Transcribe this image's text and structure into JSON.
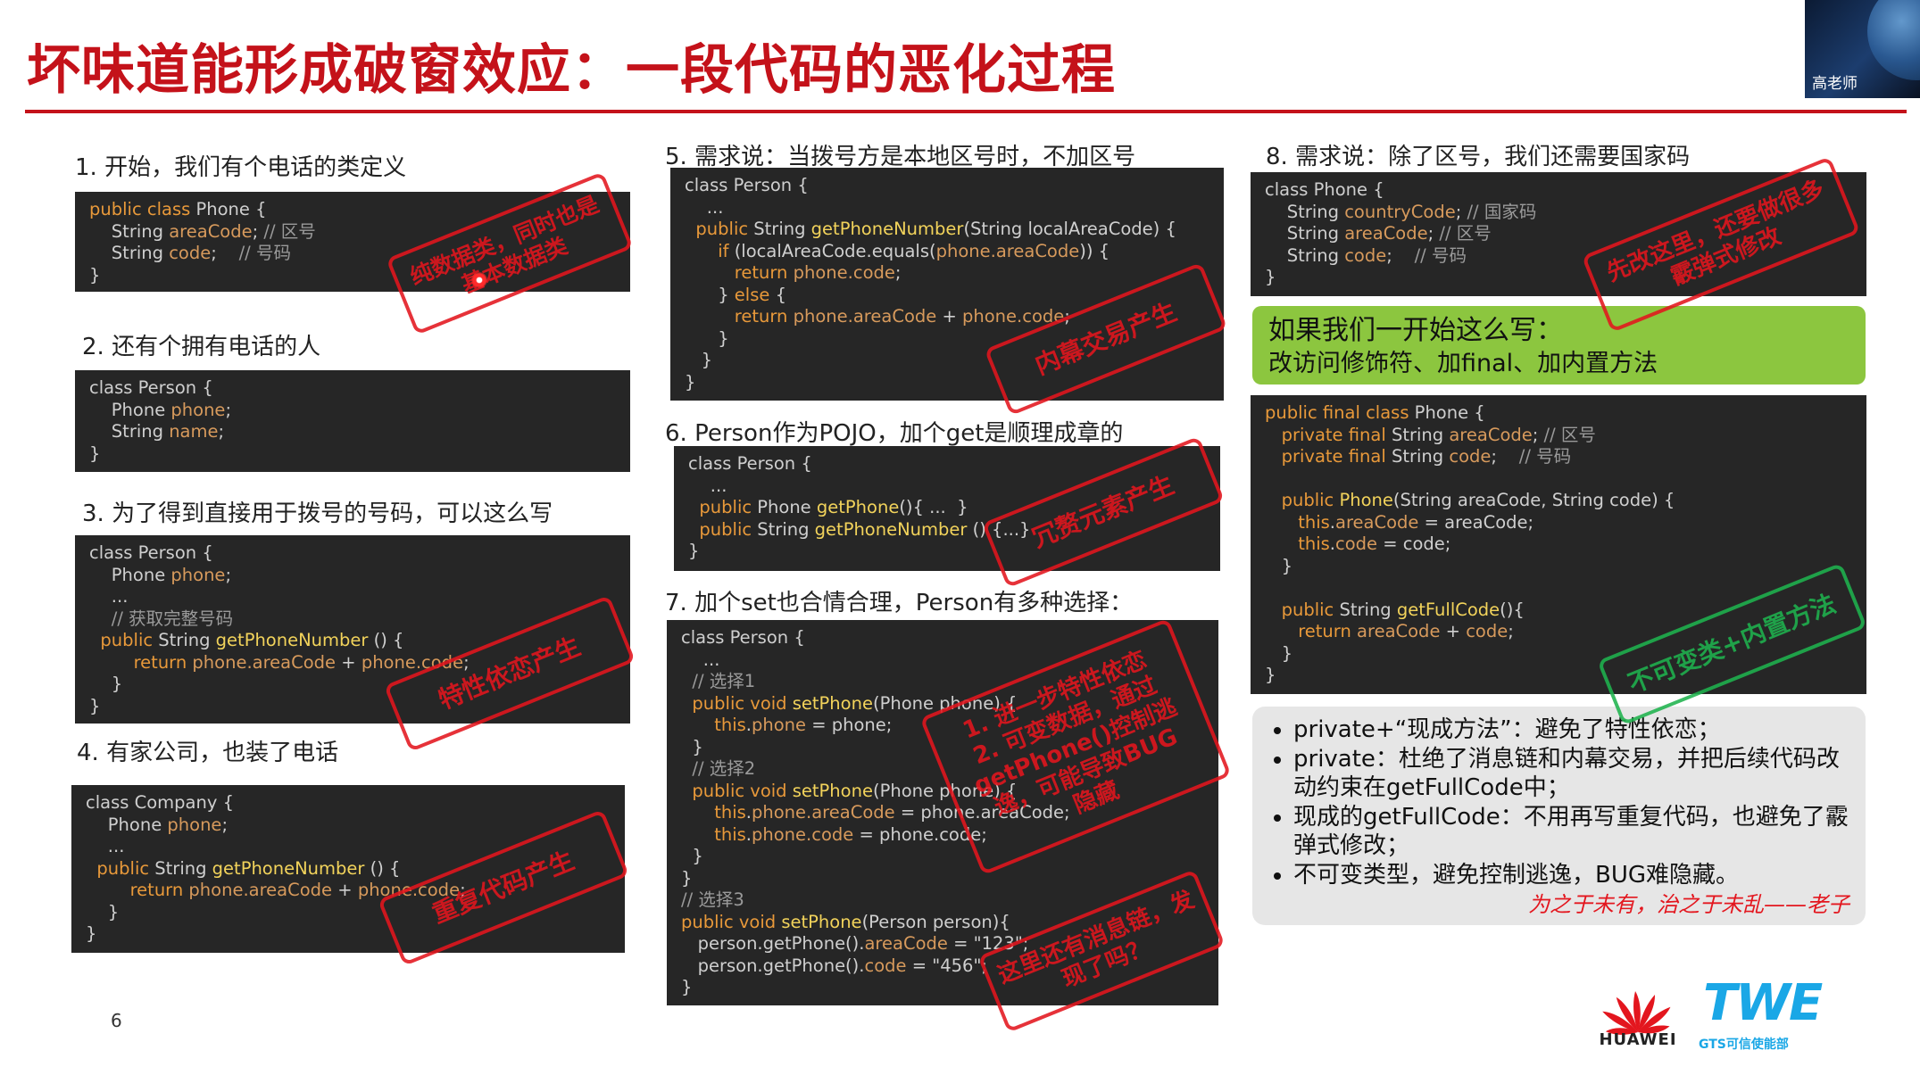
{
  "title": "坏味道能形成破窗效应：一段代码的恶化过程",
  "presenter": "高老师",
  "page_number": "6",
  "sections": [
    {
      "label": "1. 开始，我们有个电话的类定义"
    },
    {
      "label": "2. 还有个拥有电话的人"
    },
    {
      "label": "3. 为了得到直接用于拨号的号码，可以这么写"
    },
    {
      "label": "4. 有家公司，也装了电话"
    },
    {
      "label": "5. 需求说：当拨号方是本地区号时，不加区号"
    },
    {
      "label": "6. Person作为POJO，加个get是顺理成章的"
    },
    {
      "label": "7. 加个set也合情合理，Person有多种选择："
    },
    {
      "label": "8. 需求说：除了区号，我们还需要国家码"
    }
  ],
  "stamps": {
    "s1": "纯数据类，同时也是\n基本数据类",
    "s3": "特性依恋产生",
    "s4": "重复代码产生",
    "s5": "内幕交易产生",
    "s6": "冗赘元素产生",
    "s7": "1. 进一步特性依恋\n2. 可变数据，通过\ngetPhone()控制逃\n逸，可能导致BUG\n隐藏",
    "s7b": "这里还有消息链，发\n现了吗？",
    "s8": "先改这里，还要做很多\n霰弹式修改",
    "s9": "不可变类+内置方法"
  },
  "green_box": {
    "line1": "如果我们一开始这么写：",
    "line2": "改访问修饰符、加final、加内置方法"
  },
  "summary": {
    "items": [
      "private+“现成方法”：避免了特性依恋；",
      "private：杜绝了消息链和内幕交易，并把后续代码改动约束在getFullCode中；",
      "现成的getFullCode：不用再写重复代码，也避免了霰弹式修改；",
      "不可变类型，避免控制逃逸，BUG难隐藏。"
    ],
    "quote": "为之于未有，治之于未乱——老子"
  },
  "logos": {
    "huawei": "HUAWEI",
    "twe": "TWE",
    "twe_sub": "GTS可信使能部"
  },
  "colors": {
    "title_red": "#c4121a",
    "stamp_red": "#e3161e",
    "stamp_green": "#1fb34e",
    "code_bg": "#262626",
    "green_box": "#8cc63f"
  }
}
